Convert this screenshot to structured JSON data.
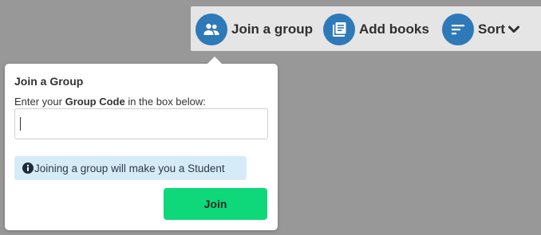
{
  "toolbar": {
    "items": [
      {
        "label": "Join a group",
        "icon": "group-icon"
      },
      {
        "label": "Add books",
        "icon": "books-icon"
      },
      {
        "label": "Sort",
        "icon": "sort-icon",
        "dropdown_icon": "chevron-down-icon"
      }
    ]
  },
  "popover": {
    "title": "Join a Group",
    "instruction_prefix": "Enter your ",
    "instruction_bold": "Group Code",
    "instruction_suffix": " in the box below:",
    "input_value": "",
    "info_text": "Joining a group will make you a Student",
    "info_icon": "info-icon",
    "join_label": "Join"
  },
  "colors": {
    "background": "#989898",
    "toolbar_background": "#e5e5e5",
    "icon_circle": "#2e79b8",
    "info_background": "#d6ebf8",
    "join_button": "#0ed87a"
  }
}
